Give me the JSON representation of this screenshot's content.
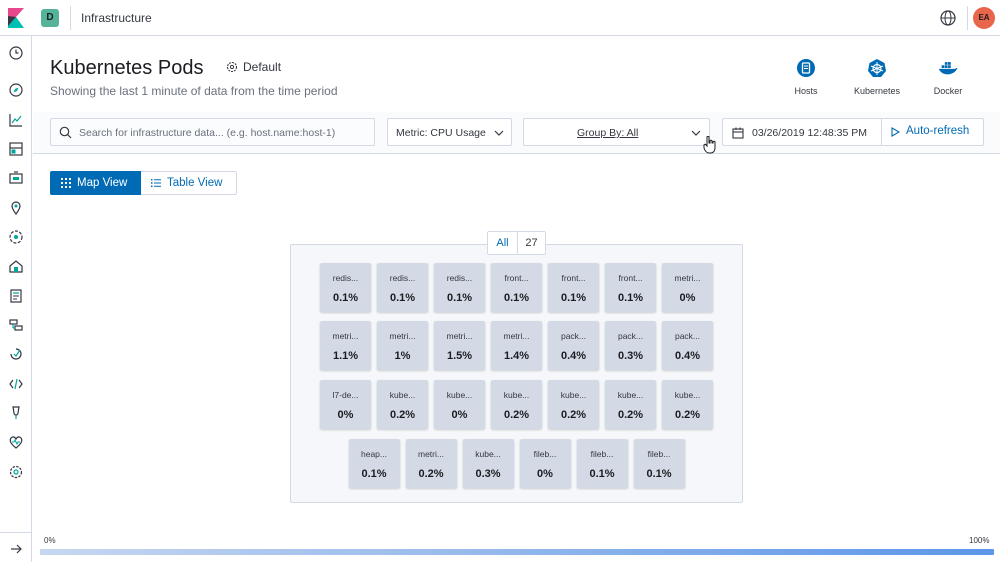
{
  "header": {
    "space_initial": "D",
    "app_title": "Infrastructure",
    "user_initials": "EA"
  },
  "page": {
    "title": "Kubernetes Pods",
    "source_label": "Default",
    "subtitle": "Showing the last 1 minute of data from the time period"
  },
  "node_types": [
    {
      "label": "Hosts",
      "icon": "hosts-icon",
      "color": "#006bb4"
    },
    {
      "label": "Kubernetes",
      "icon": "kubernetes-icon",
      "color": "#006bb4"
    },
    {
      "label": "Docker",
      "icon": "docker-icon",
      "color": "#006bb4"
    }
  ],
  "toolbar": {
    "search_placeholder": "Search for infrastructure data... (e.g. host.name:host-1)",
    "metric_label": "Metric: CPU Usage",
    "group_by_label": "Group By: All",
    "date": "03/26/2019 12:48:35 PM",
    "refresh_label": "Auto-refresh"
  },
  "view_toggle": {
    "map_label": "Map View",
    "table_label": "Table View",
    "selected": "map"
  },
  "map": {
    "group_name": "All",
    "group_count": "27",
    "rows": [
      [
        {
          "name": "redis...",
          "value": "0.1%"
        },
        {
          "name": "redis...",
          "value": "0.1%"
        },
        {
          "name": "redis...",
          "value": "0.1%"
        },
        {
          "name": "front...",
          "value": "0.1%"
        },
        {
          "name": "front...",
          "value": "0.1%"
        },
        {
          "name": "front...",
          "value": "0.1%"
        },
        {
          "name": "metri...",
          "value": "0%"
        }
      ],
      [
        {
          "name": "metri...",
          "value": "1.1%"
        },
        {
          "name": "metri...",
          "value": "1%"
        },
        {
          "name": "metri...",
          "value": "1.5%"
        },
        {
          "name": "metri...",
          "value": "1.4%"
        },
        {
          "name": "pack...",
          "value": "0.4%"
        },
        {
          "name": "pack...",
          "value": "0.3%"
        },
        {
          "name": "pack...",
          "value": "0.4%"
        }
      ],
      [
        {
          "name": "l7-de...",
          "value": "0%"
        },
        {
          "name": "kube...",
          "value": "0.2%"
        },
        {
          "name": "kube...",
          "value": "0%"
        },
        {
          "name": "kube...",
          "value": "0.2%"
        },
        {
          "name": "kube...",
          "value": "0.2%"
        },
        {
          "name": "kube...",
          "value": "0.2%"
        },
        {
          "name": "kube...",
          "value": "0.2%"
        }
      ],
      [
        {
          "name": "heap...",
          "value": "0.1%"
        },
        {
          "name": "metri...",
          "value": "0.2%"
        },
        {
          "name": "kube...",
          "value": "0.3%"
        },
        {
          "name": "fileb...",
          "value": "0%"
        },
        {
          "name": "fileb...",
          "value": "0.1%"
        },
        {
          "name": "fileb...",
          "value": "0.1%"
        }
      ]
    ]
  },
  "legend": {
    "min_label": "0%",
    "max_label": "100%",
    "color_min": "#c7d7f0",
    "color_max": "#5c96e8"
  },
  "sidebar": {
    "icons": [
      "recently-viewed-icon",
      "discover-icon",
      "visualize-icon",
      "dashboard-icon",
      "canvas-icon",
      "maps-icon",
      "machine-learning-icon",
      "infrastructure-icon",
      "logs-icon",
      "apm-icon",
      "uptime-icon",
      "dev-tools-icon",
      "monitoring-icon",
      "management-icon",
      "heartbeat-icon",
      "settings-icon"
    ],
    "collapse_icon": "collapse-arrow-icon"
  },
  "colors": {
    "accent": "#006bb4",
    "node_fill": "#d4dae5"
  }
}
